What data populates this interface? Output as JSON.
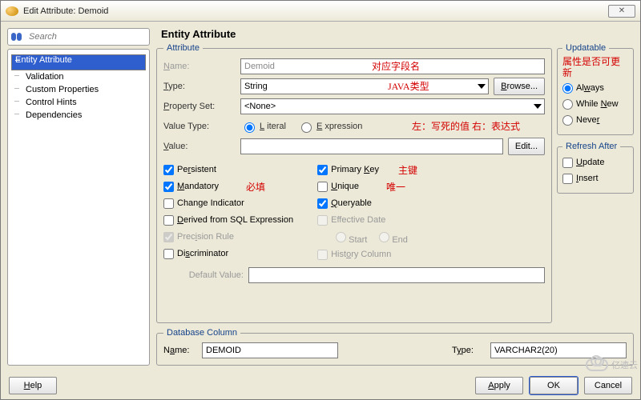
{
  "window": {
    "title": "Edit Attribute: Demoid"
  },
  "search": {
    "placeholder": "Search"
  },
  "sidebar": {
    "items": [
      {
        "label": "Entity Attribute",
        "selected": true
      },
      {
        "label": "Validation"
      },
      {
        "label": "Custom Properties"
      },
      {
        "label": "Control Hints"
      },
      {
        "label": "Dependencies"
      }
    ]
  },
  "page_title": "Entity Attribute",
  "attr": {
    "legend": "Attribute",
    "name_label": "Name:",
    "name_value": "Demoid",
    "type_label": "Type:",
    "type_value": "String",
    "browse_btn": "Browse...",
    "propset_label": "Property Set:",
    "propset_value": "<None>",
    "valuetype_label": "Value Type:",
    "literal": "Literal",
    "expression": "Expression",
    "value_label": "Value:",
    "value_value": "",
    "edit_btn": "Edit...",
    "default_label": "Default Value:",
    "default_value": ""
  },
  "checks_left": {
    "persistent": "Persistent",
    "mandatory": "Mandatory",
    "change_ind": "Change Indicator",
    "derived": "Derived from SQL Expression",
    "precision": "Precision Rule",
    "discrim": "Discriminator"
  },
  "checks_right": {
    "primary": "Primary Key",
    "unique": "Unique",
    "queryable": "Queryable",
    "eff_date": "Effective Date",
    "start": "Start",
    "end": "End",
    "history": "History Column"
  },
  "annotations": {
    "name": "对应字段名",
    "type": "JAVA类型",
    "valuetype": "左：写死的值 右：表达式",
    "primary": "主键",
    "mandatory": "必填",
    "unique": "唯一",
    "updatable": "属性是否可更新"
  },
  "updatable": {
    "legend": "Updatable",
    "always": "Always",
    "while_new": "While New",
    "never": "Never"
  },
  "refresh": {
    "legend": "Refresh After",
    "update": "Update",
    "insert": "Insert"
  },
  "db": {
    "legend": "Database Column",
    "name_label": "Name:",
    "name_value": "DEMOID",
    "type_label": "Type:",
    "type_value": "VARCHAR2(20)"
  },
  "buttons": {
    "help": "Help",
    "apply": "Apply",
    "ok": "OK",
    "cancel": "Cancel"
  },
  "watermark": "亿速云"
}
